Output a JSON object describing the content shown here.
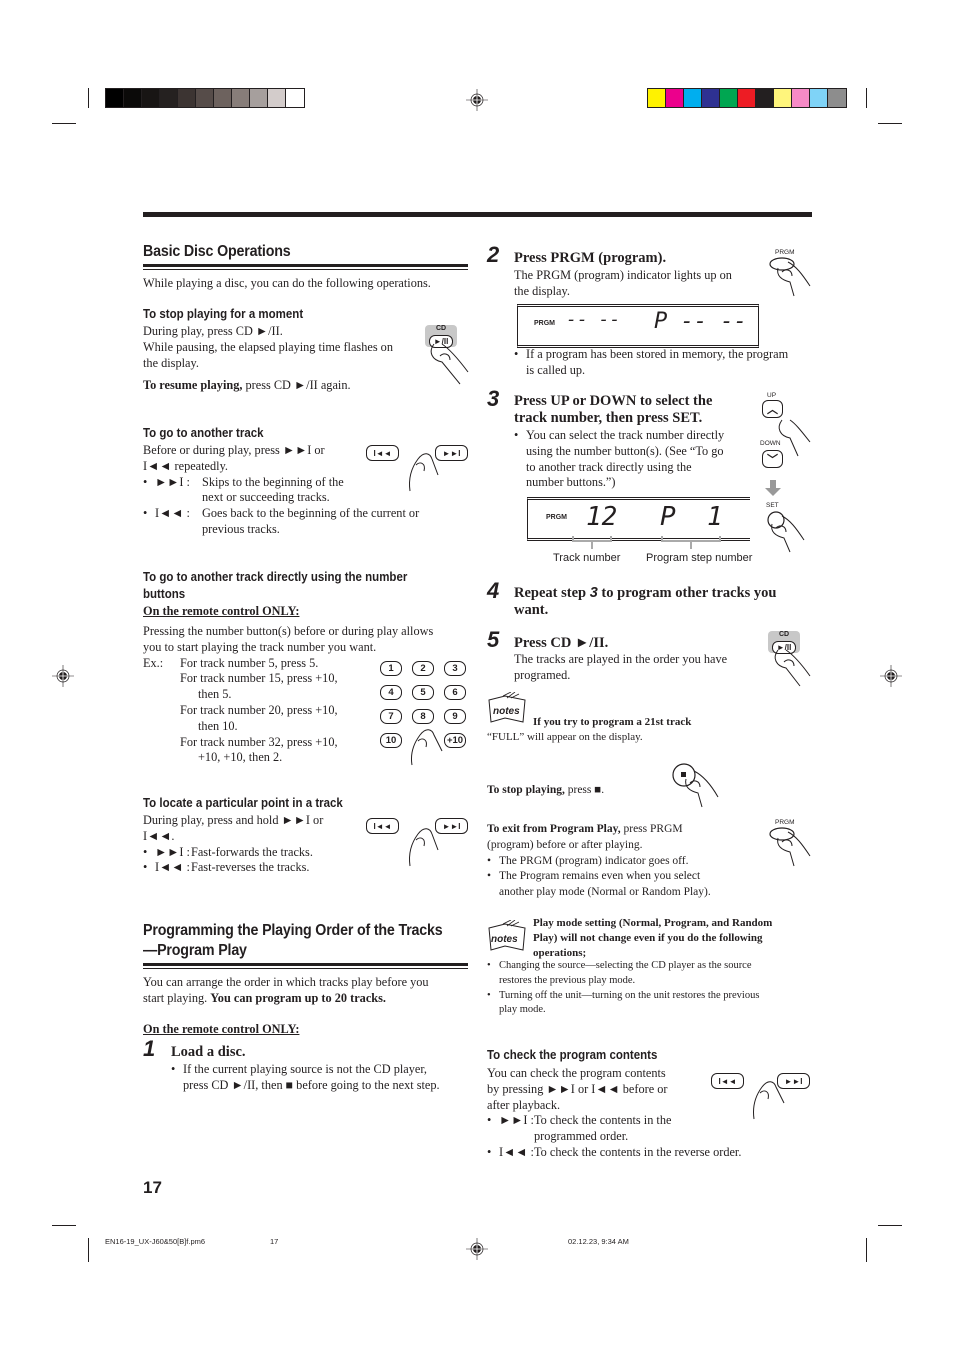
{
  "print_marks": {
    "grayscale_swatches": [
      "#000000",
      "#0b0a09",
      "#181514",
      "#252120",
      "#3c3432",
      "#564c49",
      "#6d625e",
      "#877d79",
      "#a69f9d",
      "#d3cccb",
      "#ffffff"
    ],
    "color_swatches": [
      "#fff200",
      "#ec008c",
      "#00aeef",
      "#2e3192",
      "#00a651",
      "#ed1c24",
      "#231f20",
      "#fff57c",
      "#f68ac6",
      "#7fd3f7",
      "#8d8d8d"
    ]
  },
  "left": {
    "basic": {
      "title": "Basic Disc Operations",
      "intro": "While playing a disc, you can do the following operations.",
      "stop_moment": {
        "heading": "To stop playing for a moment",
        "line1": "During play, press CD ►/II.",
        "line2": "While pausing, the elapsed playing time flashes on",
        "line3": "the display.",
        "resume_bold": "To resume playing,",
        "resume_rest": " press CD ►/II again.",
        "button_cap": "CD",
        "button_label": "►/II"
      },
      "another_track": {
        "heading": "To go to another track",
        "line1": "Before or during play, press ►►I or",
        "line2": "I◄◄ repeatedly.",
        "items": [
          {
            "sym": "►►I :",
            "text1": "Skips to the beginning of the",
            "text2": "next or succeeding tracks."
          },
          {
            "sym": "I◄◄ :",
            "text1": "Goes back to the beginning of the current or",
            "text2": "previous tracks."
          }
        ],
        "btn_prev": "I◄◄",
        "btn_next": "►►I"
      },
      "direct": {
        "heading1": "To go to another track directly using the number",
        "heading2": "buttons",
        "remote_only": "On the remote control ONLY:",
        "para1": "Pressing the number button(s) before or during play allows",
        "para2": "you to start playing the track number you want.",
        "ex_label": "Ex.:",
        "examples": [
          {
            "l1": "For track number 5, press 5.",
            "l2": ""
          },
          {
            "l1": "For track number 15, press +10,",
            "l2": "then 5."
          },
          {
            "l1": "For track number 20, press +10,",
            "l2": "then 10."
          },
          {
            "l1": "For track number 32, press +10,",
            "l2": "+10, +10, then 2."
          }
        ],
        "keypad": [
          "1",
          "2",
          "3",
          "4",
          "5",
          "6",
          "7",
          "8",
          "9",
          "10",
          "+10"
        ]
      },
      "locate": {
        "heading": "To locate a particular point in a track",
        "line1": "During play, press and hold ►►I or",
        "line2": "I◄◄.",
        "items": [
          {
            "sym": "►►I :",
            "text": "Fast-forwards the tracks."
          },
          {
            "sym": "I◄◄ :",
            "text": "Fast-reverses the tracks."
          }
        ],
        "btn_prev": "I◄◄",
        "btn_next": "►►I"
      }
    },
    "program": {
      "title1": "Programming the Playing Order of the Tracks",
      "title2": "—Program Play",
      "intro1": "You can arrange the order in which tracks play before you",
      "intro2_plain": "start playing. ",
      "intro2_bold": "You can program up to 20 tracks.",
      "remote_only": "On the remote control ONLY:",
      "step1": {
        "num": "1",
        "title": "Load a disc.",
        "bullet1": "If the current playing source is not the CD player,",
        "bullet2": "press CD ►/II, then ■ before going to the next step."
      }
    }
  },
  "right": {
    "step2": {
      "num": "2",
      "title": "Press PRGM (program).",
      "line1": "The PRGM (program) indicator lights up on",
      "line2": "the display.",
      "button_label": "PRGM",
      "display": {
        "indicator": "PRGM",
        "track": "-- --",
        "step": "P -- --"
      },
      "bullet1": "If a program has been stored in memory, the program",
      "bullet2": "is called up."
    },
    "step3": {
      "num": "3",
      "title1": "Press UP or DOWN to select the",
      "title2": "track number, then press SET.",
      "bullet": [
        "You can select the track number directly",
        "using the number button(s). (See “To go",
        "to another track directly using the",
        "number buttons.”)"
      ],
      "up_label": "UP",
      "down_label": "DOWN",
      "set_label": "SET",
      "display": {
        "indicator": "PRGM",
        "track": "12",
        "step": "P  1"
      },
      "caption_track": "Track number",
      "caption_step": "Program step number"
    },
    "step4": {
      "num": "4",
      "title_a": "Repeat step ",
      "title_num": "3",
      "title_b": " to program other tracks you",
      "title_c": "want."
    },
    "step5": {
      "num": "5",
      "title": "Press CD ►/II.",
      "line1": "The tracks are played in the order you have",
      "line2": "programed.",
      "button_cap": "CD",
      "button_label": "►/II"
    },
    "note1": {
      "icon_label": "notes",
      "heading": "If you try to program a 21st track",
      "text": "“FULL” will appear on the display."
    },
    "stop": {
      "bold": "To stop playing,",
      "rest": " press ■."
    },
    "exit": {
      "bold": "To exit from Program Play,",
      "rest": " press PRGM",
      "line2": "(program) before or after playing.",
      "bullets": [
        "The PRGM (program) indicator goes off.",
        "The Program remains even when you select"
      ],
      "bullet2_cont": "another play mode (Normal or Random Play).",
      "button_label": "PRGM"
    },
    "note2": {
      "icon_label": "notes",
      "heading1": "Play mode setting (Normal, Program, and Random",
      "heading2": "Play) will not change even if you do the following",
      "heading3": "operations;",
      "bullets": [
        {
          "l1": "Changing the source—selecting the CD player as the source",
          "l2": "restores the previous play mode."
        },
        {
          "l1": "Turning off the unit—turning on the unit restores the previous",
          "l2": "play mode."
        }
      ]
    },
    "check": {
      "heading": "To check the program contents",
      "line1": "You can check the program contents",
      "line2": "by pressing ►►I or I◄◄ before or",
      "line3": "after playback.",
      "items": [
        {
          "sym": "►►I :",
          "t1": "To check the contents in the",
          "t2": "programmed order."
        },
        {
          "sym": "I◄◄ :",
          "t1": "To check the contents in the reverse order.",
          "t2": ""
        }
      ],
      "btn_prev": "I◄◄",
      "btn_next": "►►I"
    }
  },
  "page_number": "17",
  "slug": {
    "file": "EN16-19_UX-J60&50[B]f.pm6",
    "page": "17",
    "date": "02.12.23, 9:34 AM"
  }
}
